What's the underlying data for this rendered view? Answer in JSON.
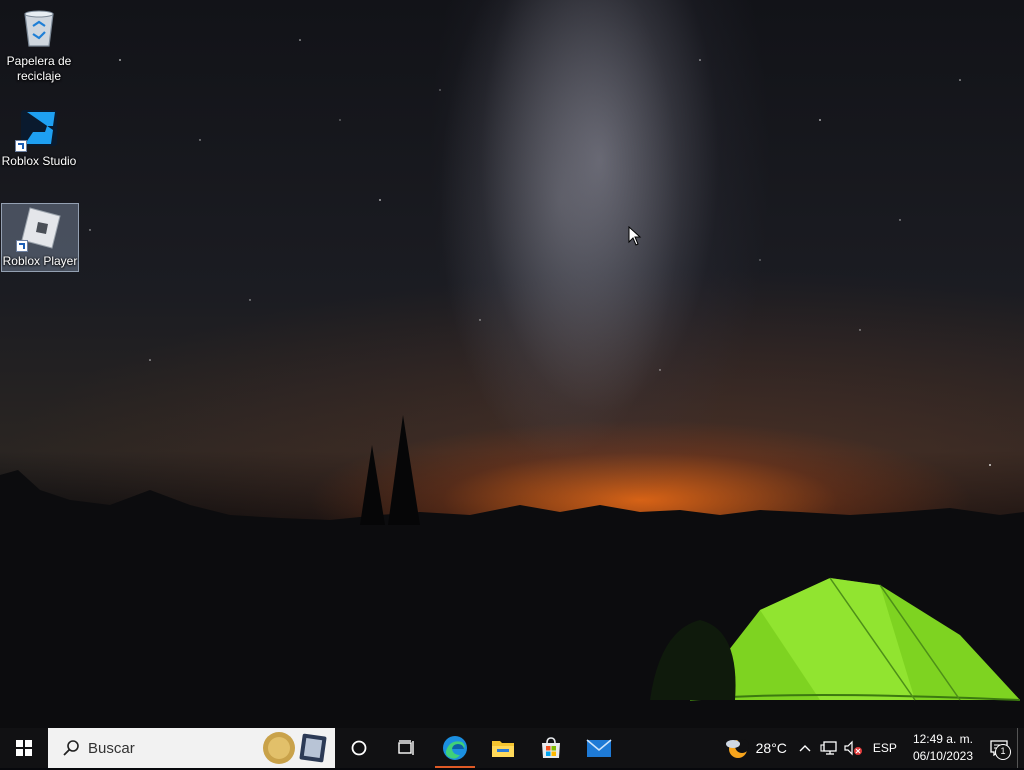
{
  "desktop": {
    "icons": [
      {
        "label": "Papelera de\nreciclaje",
        "icon": "recycle-bin-icon"
      },
      {
        "label": "Roblox Studio",
        "icon": "roblox-studio-icon"
      },
      {
        "label": "Roblox Player",
        "icon": "roblox-player-icon",
        "selected": true
      }
    ]
  },
  "taskbar": {
    "search_placeholder": "Buscar",
    "apps": [
      {
        "name": "cortana",
        "icon": "cortana-circle-icon"
      },
      {
        "name": "task-view",
        "icon": "task-view-icon"
      },
      {
        "name": "edge",
        "icon": "edge-icon",
        "active": true
      },
      {
        "name": "file-explorer",
        "icon": "folder-icon"
      },
      {
        "name": "store",
        "icon": "store-icon"
      },
      {
        "name": "mail",
        "icon": "mail-icon"
      }
    ],
    "tray": {
      "temperature": "28°C",
      "language": "ESP",
      "time": "12:49 a. m.",
      "date": "06/10/2023",
      "notification_count": "1"
    }
  },
  "colors": {
    "taskbar_bg": "#111113",
    "edge_active_underline": "#e05a26",
    "tent_green": "#7ed321"
  }
}
